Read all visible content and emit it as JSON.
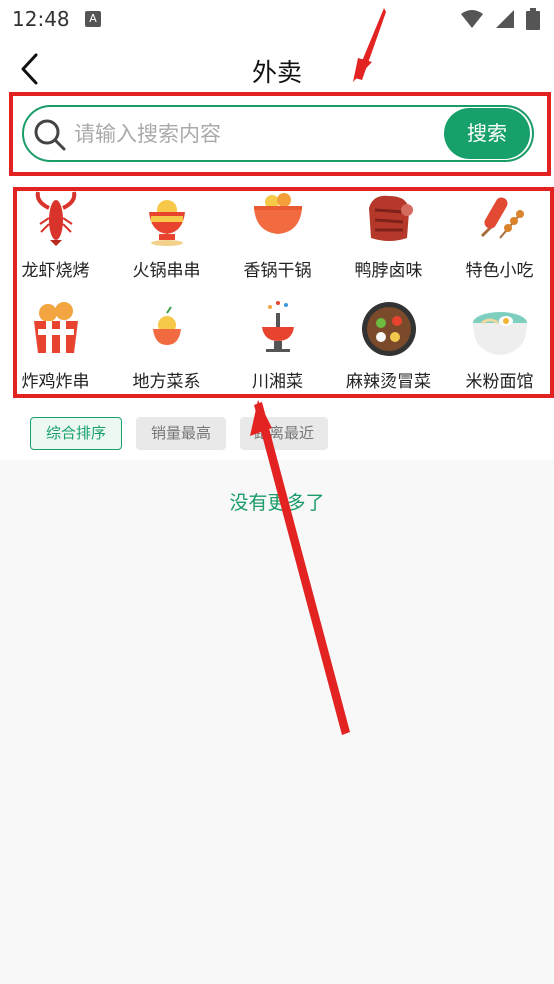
{
  "status_bar": {
    "time": "12:48",
    "notification_icon": "a-letter-icon",
    "icons": [
      "wifi-icon",
      "signal-icon",
      "battery-icon"
    ]
  },
  "header": {
    "title": "外卖",
    "back_icon": "chevron-left-icon"
  },
  "search": {
    "placeholder": "请输入搜索内容",
    "value": "",
    "button_label": "搜索",
    "icon": "search-icon"
  },
  "categories": [
    {
      "label": "龙虾烧烤",
      "icon": "crayfish-icon"
    },
    {
      "label": "火锅串串",
      "icon": "hotpot-icon"
    },
    {
      "label": "香锅干锅",
      "icon": "dry-pot-icon"
    },
    {
      "label": "鸭脖卤味",
      "icon": "braised-meat-icon"
    },
    {
      "label": "特色小吃",
      "icon": "skewer-icon"
    },
    {
      "label": "炸鸡炸串",
      "icon": "fried-chicken-icon"
    },
    {
      "label": "地方菜系",
      "icon": "rice-bowl-icon"
    },
    {
      "label": "川湘菜",
      "icon": "chinese-hotpot-icon"
    },
    {
      "label": "麻辣烫冒菜",
      "icon": "spicy-soup-icon"
    },
    {
      "label": "米粉面馆",
      "icon": "noodle-bowl-icon"
    }
  ],
  "filters": [
    {
      "label": "综合排序",
      "active": true
    },
    {
      "label": "销量最高",
      "active": false
    },
    {
      "label": "距离最近",
      "active": false
    }
  ],
  "empty_message": "没有更多了",
  "colors": {
    "accent": "#17a06a",
    "annotation": "#e32222",
    "background": "#f8f8f8"
  }
}
